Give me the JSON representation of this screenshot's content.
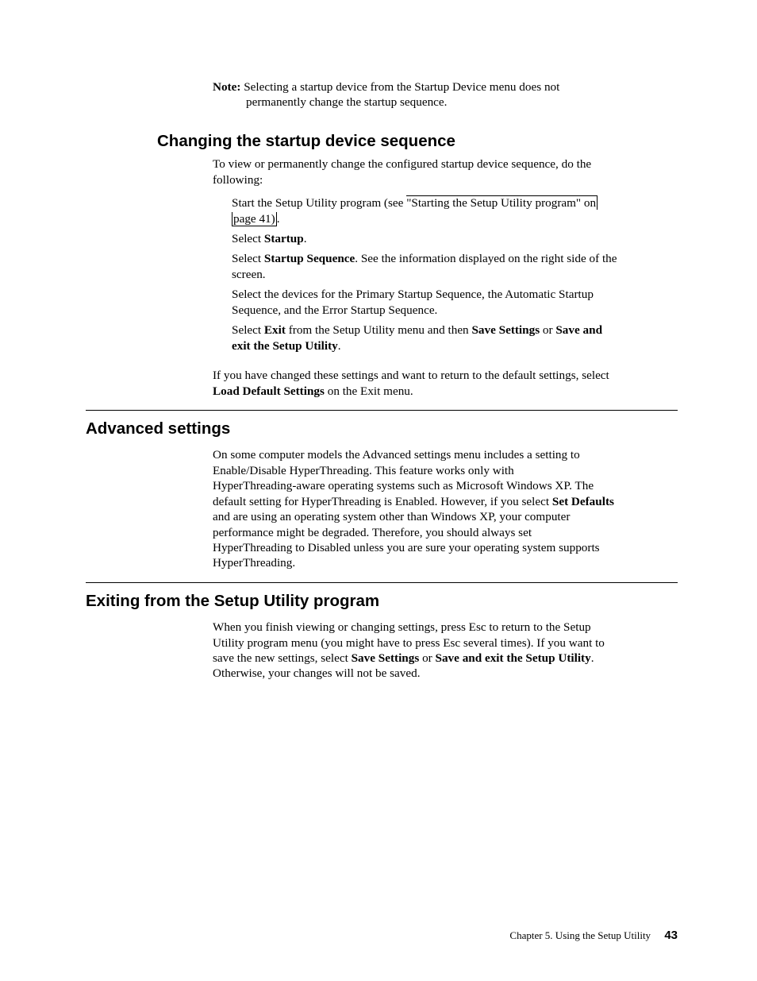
{
  "note": {
    "label": "Note:",
    "line1": "Selecting a startup device from the Startup Device menu does not",
    "line2": "permanently change the startup sequence."
  },
  "s1": {
    "heading": "Changing the startup device sequence",
    "intro1": "To view or permanently change the configured startup device sequence, do the",
    "intro2": "following:",
    "i1a": "Start the Setup Utility program (see ",
    "i1_link_a": "\"Starting the Setup Utility program\" on",
    "i1_link_b": "page 41)",
    "i1b": ".",
    "i2a": "Select ",
    "i2b": "Startup",
    "i2c": ".",
    "i3a": "Select ",
    "i3b": "Startup Sequence",
    "i3c": ". See the information displayed on the right side of the",
    "i3d": "screen.",
    "i4a": "Select the devices for the Primary Startup Sequence, the Automatic Startup",
    "i4b": "Sequence, and the Error Startup Sequence.",
    "i5a": "Select ",
    "i5b": "Exit",
    "i5c": " from the Setup Utility menu and then ",
    "i5d": "Save Settings",
    "i5e": " or ",
    "i5f": "Save and",
    "i5g": "exit the Setup Utility",
    "i5h": ".",
    "tail1": "If you have changed these settings and want to return to the default settings, select",
    "tail2a": "Load Default Settings",
    "tail2b": " on the Exit menu."
  },
  "s2": {
    "heading": "Advanced settings",
    "p1": "On some computer models the Advanced settings menu includes a setting to",
    "p2": "Enable/Disable HyperThreading. This feature works only with",
    "p3": "HyperThreading-aware operating systems such as Microsoft Windows XP. The",
    "p4a": "default setting for HyperThreading is Enabled. However, if you select ",
    "p4b": "Set Defaults",
    "p5": "and are using an operating system other than Windows XP, your computer",
    "p6": "performance might be degraded. Therefore, you should always set",
    "p7": "HyperThreading to Disabled unless you are sure your operating system supports",
    "p8": "HyperThreading."
  },
  "s3": {
    "heading": "Exiting from the Setup Utility program",
    "p1": "When you finish viewing or changing settings, press Esc to return to the Setup",
    "p2": "Utility program menu (you might have to press Esc several times). If you want to",
    "p3a": "save the new settings, select ",
    "p3b": "Save Settings",
    "p3c": " or ",
    "p3d": "Save and exit the Setup Utility",
    "p3e": ".",
    "p4": "Otherwise, your changes will not be saved."
  },
  "footer": {
    "chapter": "Chapter 5. Using the Setup Utility",
    "page": "43"
  }
}
